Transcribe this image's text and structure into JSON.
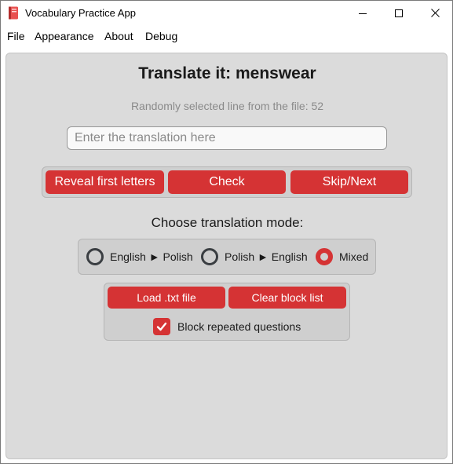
{
  "window": {
    "title": "Vocabulary Practice App",
    "icon": "book-icon"
  },
  "menu": {
    "items": [
      "File",
      "Appearance",
      "About",
      "Debug"
    ]
  },
  "main": {
    "heading": "Translate it: menswear",
    "subheading": "Randomly selected line from the file: 52",
    "entry": {
      "placeholder": "Enter the translation here",
      "value": ""
    },
    "buttons": {
      "reveal": "Reveal first letters",
      "check": "Check",
      "skip": "Skip/Next"
    },
    "mode_label": "Choose translation mode:",
    "modes": [
      {
        "label": "English ► Polish",
        "selected": false
      },
      {
        "label": "Polish ► English",
        "selected": false
      },
      {
        "label": "Mixed",
        "selected": true
      }
    ],
    "file_buttons": {
      "load": "Load .txt file",
      "clear": "Clear block list"
    },
    "block_repeated": {
      "label": "Block repeated questions",
      "checked": true
    }
  },
  "colors": {
    "accent": "#d53334",
    "frame_bg": "#dbdbdb",
    "inner_frame_bg": "#cfcfcf",
    "text": "#1a1a1a",
    "muted_text": "#8a8a8a"
  }
}
